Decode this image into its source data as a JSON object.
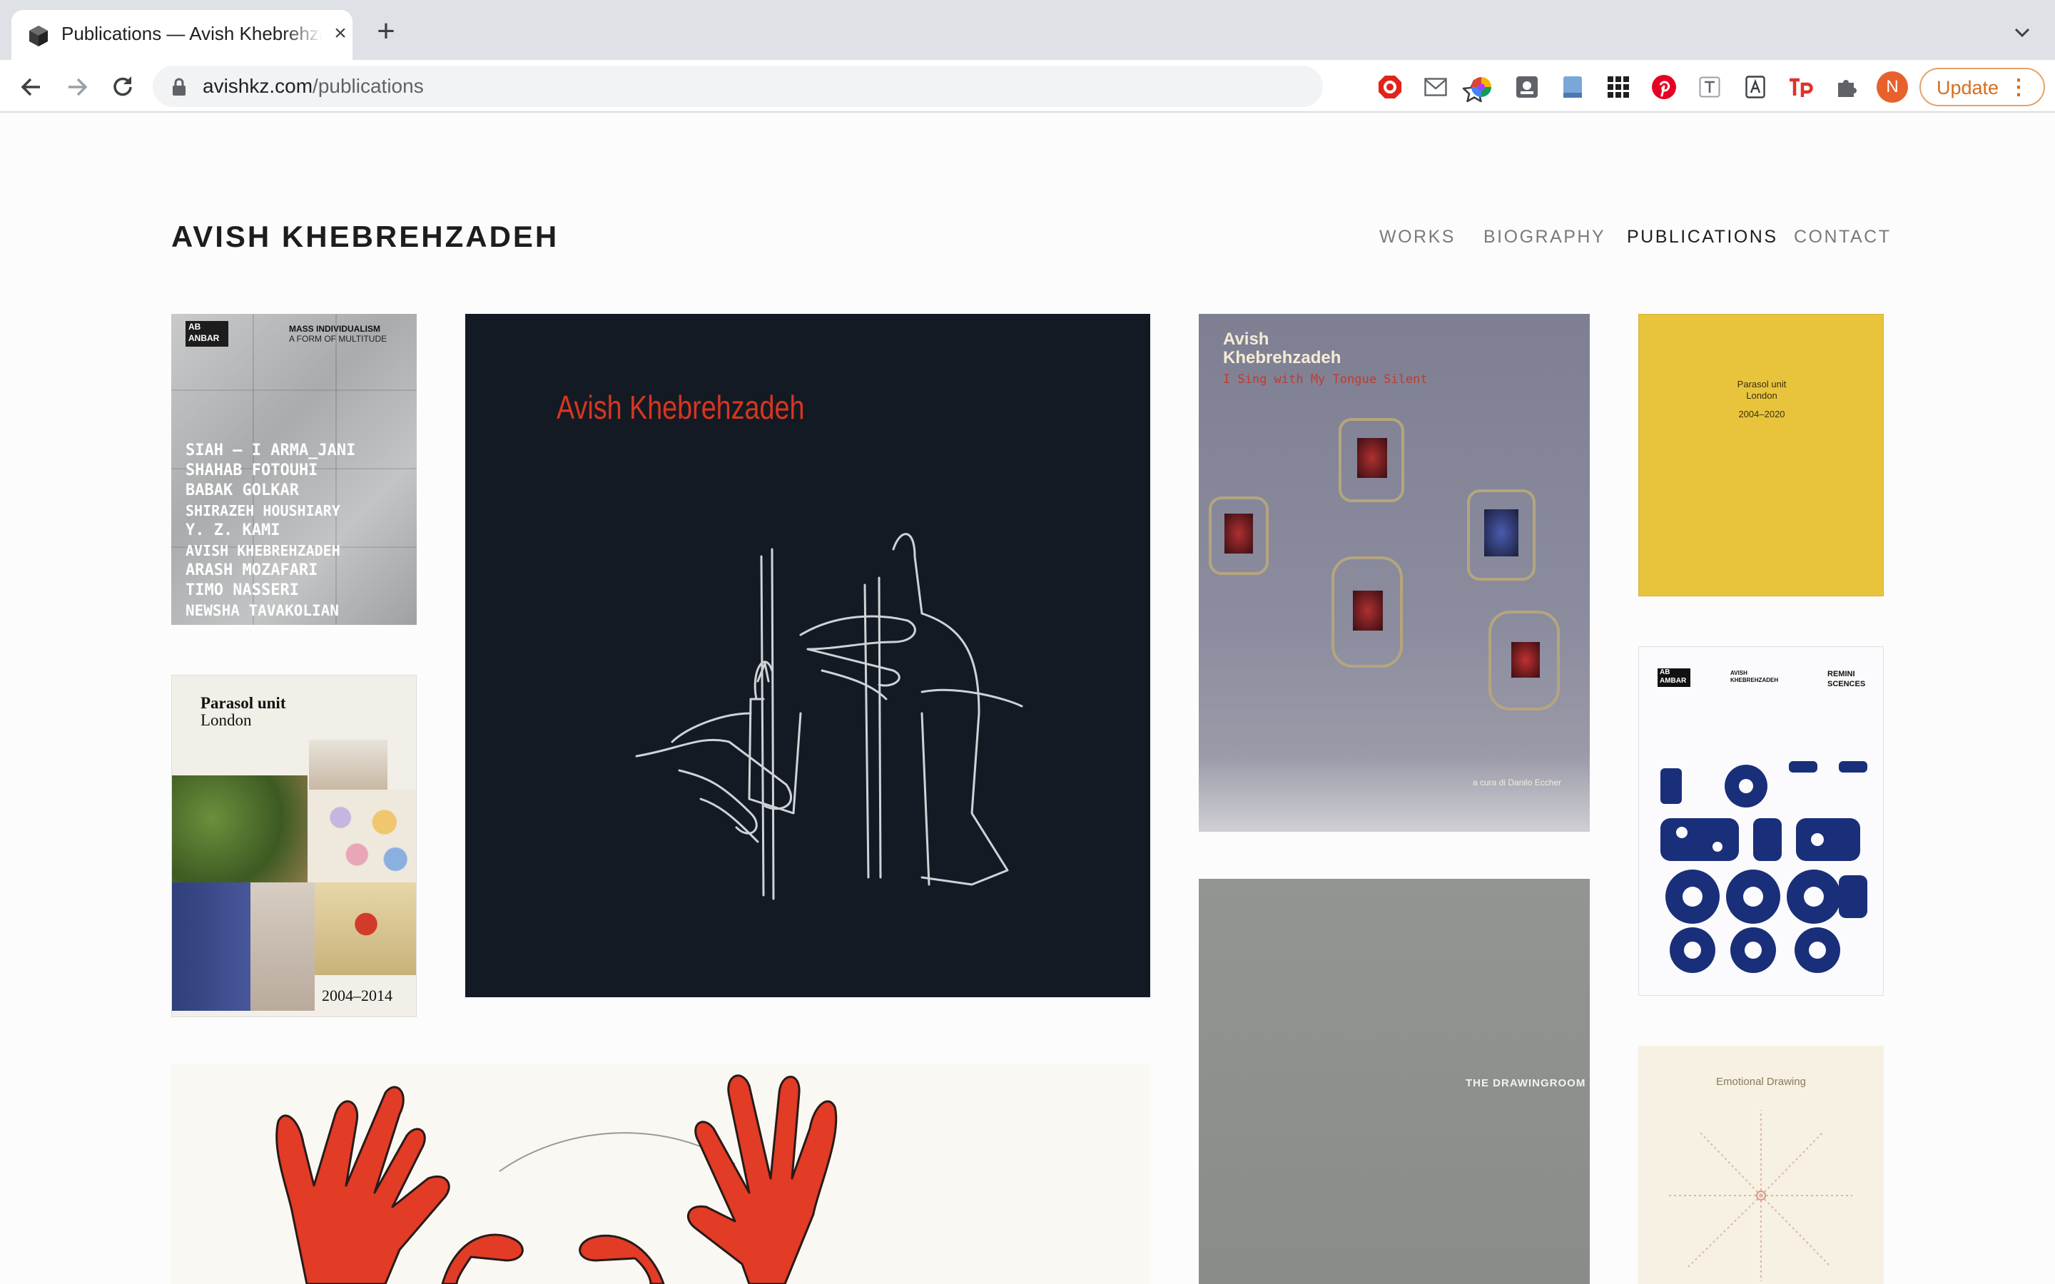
{
  "browser": {
    "tab_title": "Publications — Avish Khebrehzadeh",
    "url_domain": "avishkz.com",
    "url_path": "/publications",
    "profile_initial": "N",
    "update_label": "Update",
    "extensions": [
      "adblock-icon",
      "mail-icon",
      "color-wheel-icon",
      "screenshot-icon",
      "reader-icon",
      "apps-grid-icon",
      "pinterest-icon",
      "text-icon",
      "translate-icon",
      "tp-icon",
      "puzzle-icon"
    ]
  },
  "site": {
    "title": "AVISH KHEBREHZADEH",
    "nav": [
      {
        "label": "WORKS",
        "active": false
      },
      {
        "label": "BIOGRAPHY",
        "active": false
      },
      {
        "label": "PUBLICATIONS",
        "active": true
      },
      {
        "label": "CONTACT",
        "active": false
      }
    ]
  },
  "covers": {
    "mass": {
      "ab": "AB",
      "ambar": "ANBAR",
      "title": "MASS INDIVIDUALISM",
      "subtitle": "A FORM OF MULTITUDE",
      "names": [
        "SIAH — I ARMA_JANI",
        "SHAHAB FOTOUHI",
        "BABAK GOLKAR",
        "SHIRAZEH HOUSHIARY",
        "Y. Z. KAMI",
        "AVISH KHEBREHZADEH",
        "ARASH MOZAFARI",
        "TIMO NASSERI",
        "NEWSHA TAVAKOLIAN"
      ]
    },
    "black_book": {
      "title": "Avish Khebrehzadeh"
    },
    "grey_book": {
      "title_line1": "Avish",
      "title_line2": "Khebrehzadeh",
      "subtitle": "I Sing with My Tongue Silent",
      "credit": "a cura di Danilo Eccher"
    },
    "yellow_book": {
      "line1": "Parasol unit",
      "line2": "London",
      "years": "2004–2020"
    },
    "parasol_2014": {
      "line1": "Parasol unit",
      "line2": "London",
      "years": "2004–2014"
    },
    "reminiscences": {
      "ab": "AB",
      "ambar": "AMBAR",
      "author1": "AVISH",
      "author2": "KHEBREHZADEH",
      "title1": "REMINI",
      "title2": "SCENCES"
    },
    "drawingroom": {
      "title": "THE DRAWINGROOM"
    },
    "emotional": {
      "title": "Emotional Drawing"
    }
  },
  "colors": {
    "accent_red": "#d7361f",
    "update_orange": "#d56e1e",
    "yellow_cover": "#e7c43c",
    "navy_ink": "#1a2f7a"
  }
}
